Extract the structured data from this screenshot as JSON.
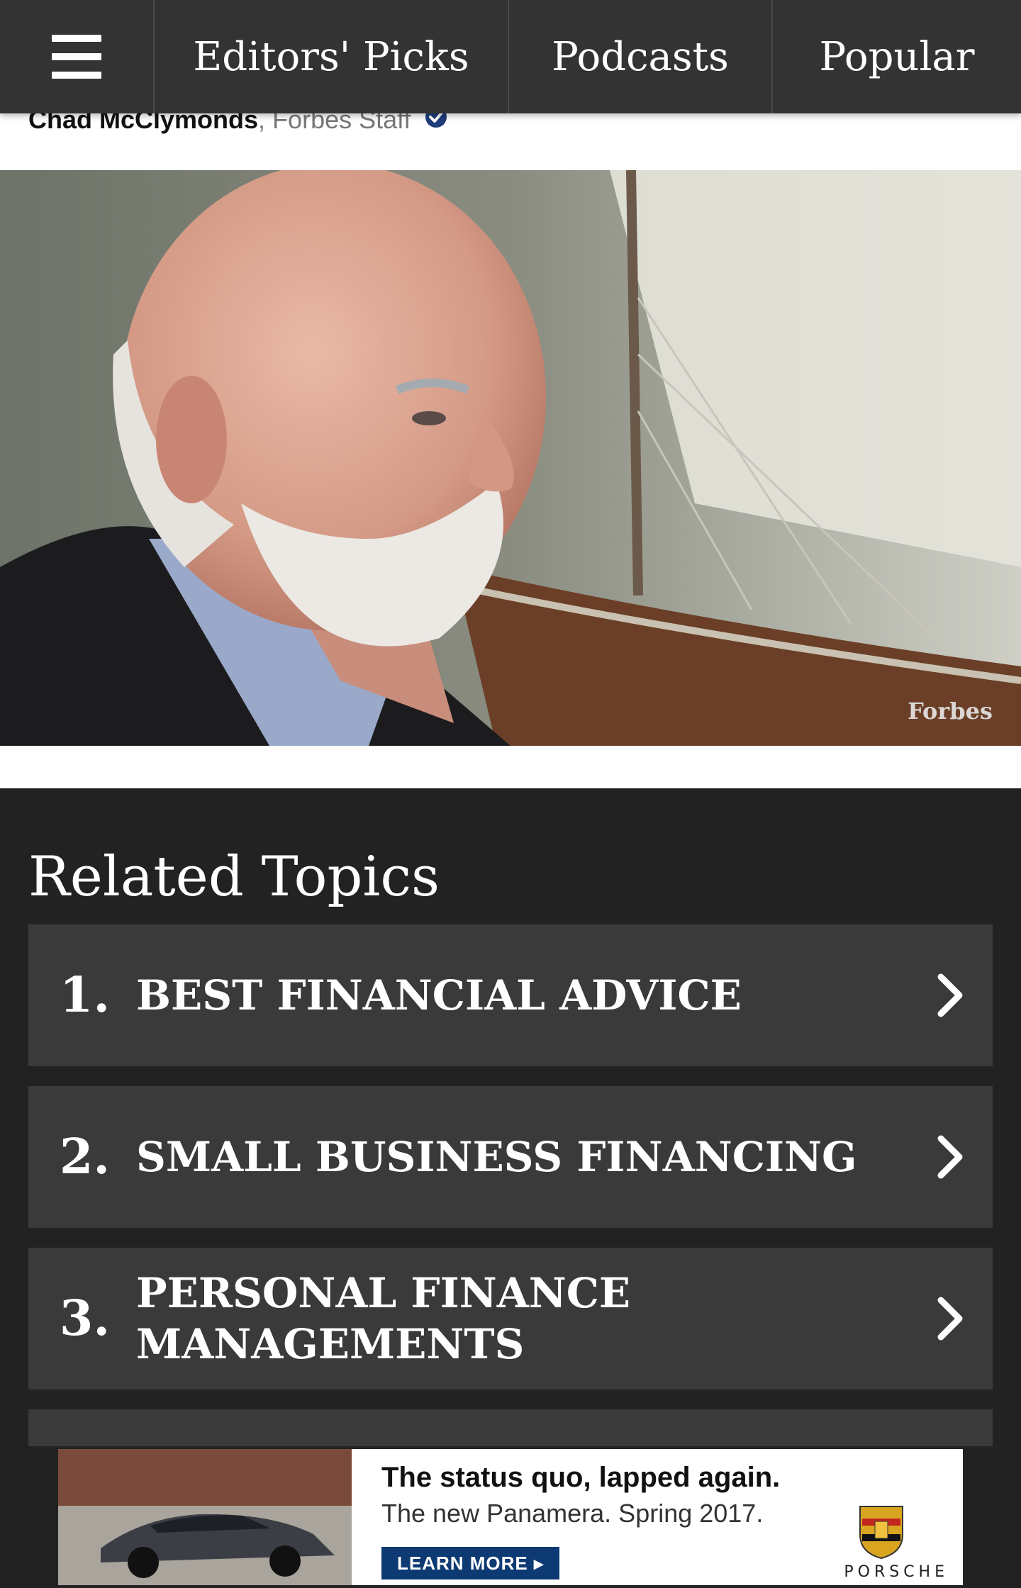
{
  "nav": {
    "items": [
      {
        "label": "Editors' Picks"
      },
      {
        "label": "Podcasts"
      },
      {
        "label": "Popular"
      }
    ]
  },
  "byline": {
    "author": "Chad McClymonds",
    "separator": ", ",
    "role": "Forbes Staff"
  },
  "hero": {
    "credit": "Forbes"
  },
  "related": {
    "title": "Related Topics",
    "topics": [
      {
        "number": "1.",
        "label": "BEST FINANCIAL ADVICE"
      },
      {
        "number": "2.",
        "label": "SMALL BUSINESS FINANCING"
      },
      {
        "number": "3.",
        "label": "PERSONAL FINANCE MANAGEMENTS"
      }
    ]
  },
  "ad": {
    "headline": "The status quo, lapped again.",
    "subline": "The new Panamera. Spring 2017.",
    "cta": "LEARN MORE ▸",
    "brand": "PORSCHE"
  },
  "colors": {
    "nav_bg": "#333333",
    "related_bg": "#222222",
    "topic_bg": "#3a3a3a",
    "verified_blue": "#1f3d7a",
    "ad_cta": "#0d3a73"
  }
}
